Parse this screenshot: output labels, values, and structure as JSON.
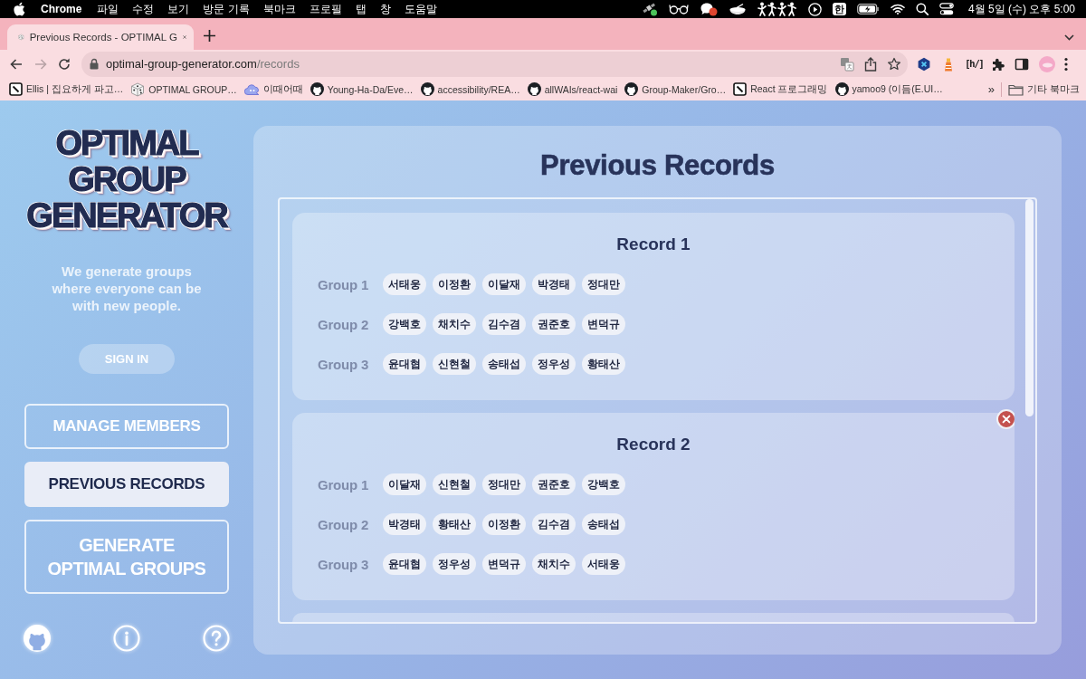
{
  "menu_bar": {
    "app": "Chrome",
    "menus": [
      "파일",
      "수정",
      "보기",
      "방문 기록",
      "북마크",
      "프로필",
      "탭",
      "창",
      "도움말"
    ],
    "input_indicator": "한",
    "clock": "4월 5일 (수) 오후 5:00"
  },
  "browser": {
    "tabs": [
      {
        "title": "Previous Records - OPTIMAL G",
        "selected": true
      }
    ],
    "forward_disabled": true,
    "url": "optimal-group-generator.com/records",
    "extension_label": "[h/]",
    "bookmarks": [
      {
        "kind": "square",
        "label": "Ellis | 집요하게 파고…"
      },
      {
        "kind": "dice",
        "label": "OPTIMAL GROUP…"
      },
      {
        "kind": "cloud",
        "label": "이때어때"
      },
      {
        "kind": "github",
        "label": "Young-Ha-Da/Eve…"
      },
      {
        "kind": "github",
        "label": "accessibility/REA…"
      },
      {
        "kind": "github",
        "label": "allWAIs/react-wai"
      },
      {
        "kind": "github",
        "label": "Group-Maker/Gro…"
      },
      {
        "kind": "square",
        "label": "React 프로그래밍"
      },
      {
        "kind": "github",
        "label": "yamoo9 (이듬(E.UI…"
      }
    ],
    "bookmarks_overflow": "»",
    "other_bookmarks": "기타 북마크"
  },
  "sidebar": {
    "logo": "OPTIMAL GROUP GENERATOR",
    "tagline": "We generate groups where everyone can be with new people.",
    "sign_in": "SIGN IN",
    "nav": [
      {
        "label": "MANAGE MEMBERS",
        "kind": "link",
        "selected": false
      },
      {
        "label": "PREVIOUS RECORDS",
        "kind": "link",
        "selected": true
      },
      {
        "label": "GENERATE OPTIMAL GROUPS",
        "kind": "action",
        "selected": false
      }
    ]
  },
  "main": {
    "title": "Previous Records",
    "more_below": true,
    "records": [
      {
        "title": "Record 1",
        "delete_visible": false,
        "groups": [
          {
            "label": "Group 1",
            "members": [
              "서태웅",
              "이정환",
              "이달재",
              "박경태",
              "정대만"
            ]
          },
          {
            "label": "Group 2",
            "members": [
              "강백호",
              "채치수",
              "김수겸",
              "권준호",
              "변덕규"
            ]
          },
          {
            "label": "Group 3",
            "members": [
              "윤대협",
              "신현철",
              "송태섭",
              "정우성",
              "황태산"
            ]
          }
        ]
      },
      {
        "title": "Record 2",
        "delete_visible": true,
        "groups": [
          {
            "label": "Group 1",
            "members": [
              "이달재",
              "신현철",
              "정대만",
              "권준호",
              "강백호"
            ]
          },
          {
            "label": "Group 2",
            "members": [
              "박경태",
              "황태산",
              "이정환",
              "김수겸",
              "송태섭"
            ]
          },
          {
            "label": "Group 3",
            "members": [
              "윤대협",
              "정우성",
              "변덕규",
              "채치수",
              "서태웅"
            ]
          }
        ]
      }
    ]
  }
}
